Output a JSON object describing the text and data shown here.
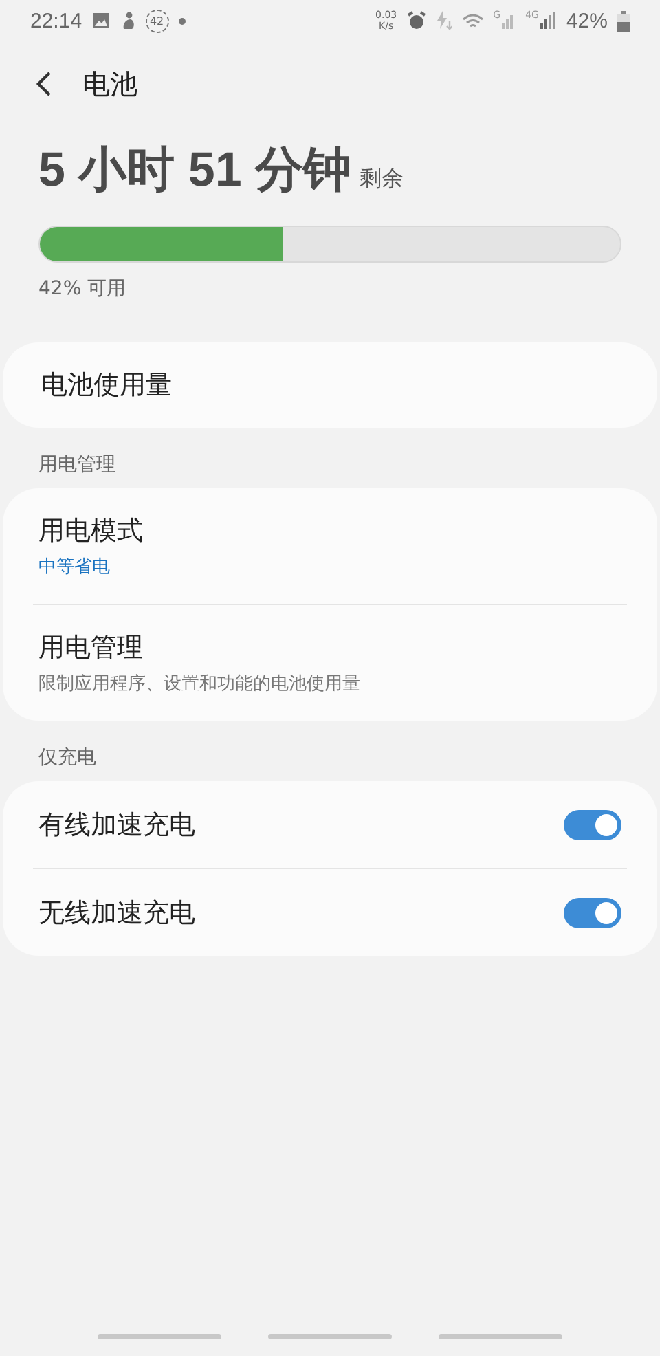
{
  "status_bar": {
    "time": "22:14",
    "notification_count": "42",
    "net_speed": "0.03",
    "net_speed_unit": "K/s",
    "sim1_network": "G",
    "sim2_network": "4G",
    "battery_percent": "42%"
  },
  "header": {
    "title": "电池"
  },
  "summary": {
    "time_left": "5 小时 51 分钟",
    "time_left_suffix": "剩余",
    "level": 0.42,
    "available": "42% 可用"
  },
  "usage_item": {
    "label": "电池使用量"
  },
  "sections": [
    {
      "heading": "用电管理",
      "items": [
        {
          "kind": "link",
          "title": "用电模式",
          "subtitle": "中等省电",
          "subtitle_accent": true
        },
        {
          "kind": "link",
          "title": "用电管理",
          "subtitle": "限制应用程序、设置和功能的电池使用量",
          "subtitle_accent": false
        }
      ]
    },
    {
      "heading": "仅充电",
      "items": [
        {
          "kind": "switch",
          "title": "有线加速充电",
          "on": true
        },
        {
          "kind": "switch",
          "title": "无线加速充电",
          "on": true
        }
      ]
    }
  ]
}
